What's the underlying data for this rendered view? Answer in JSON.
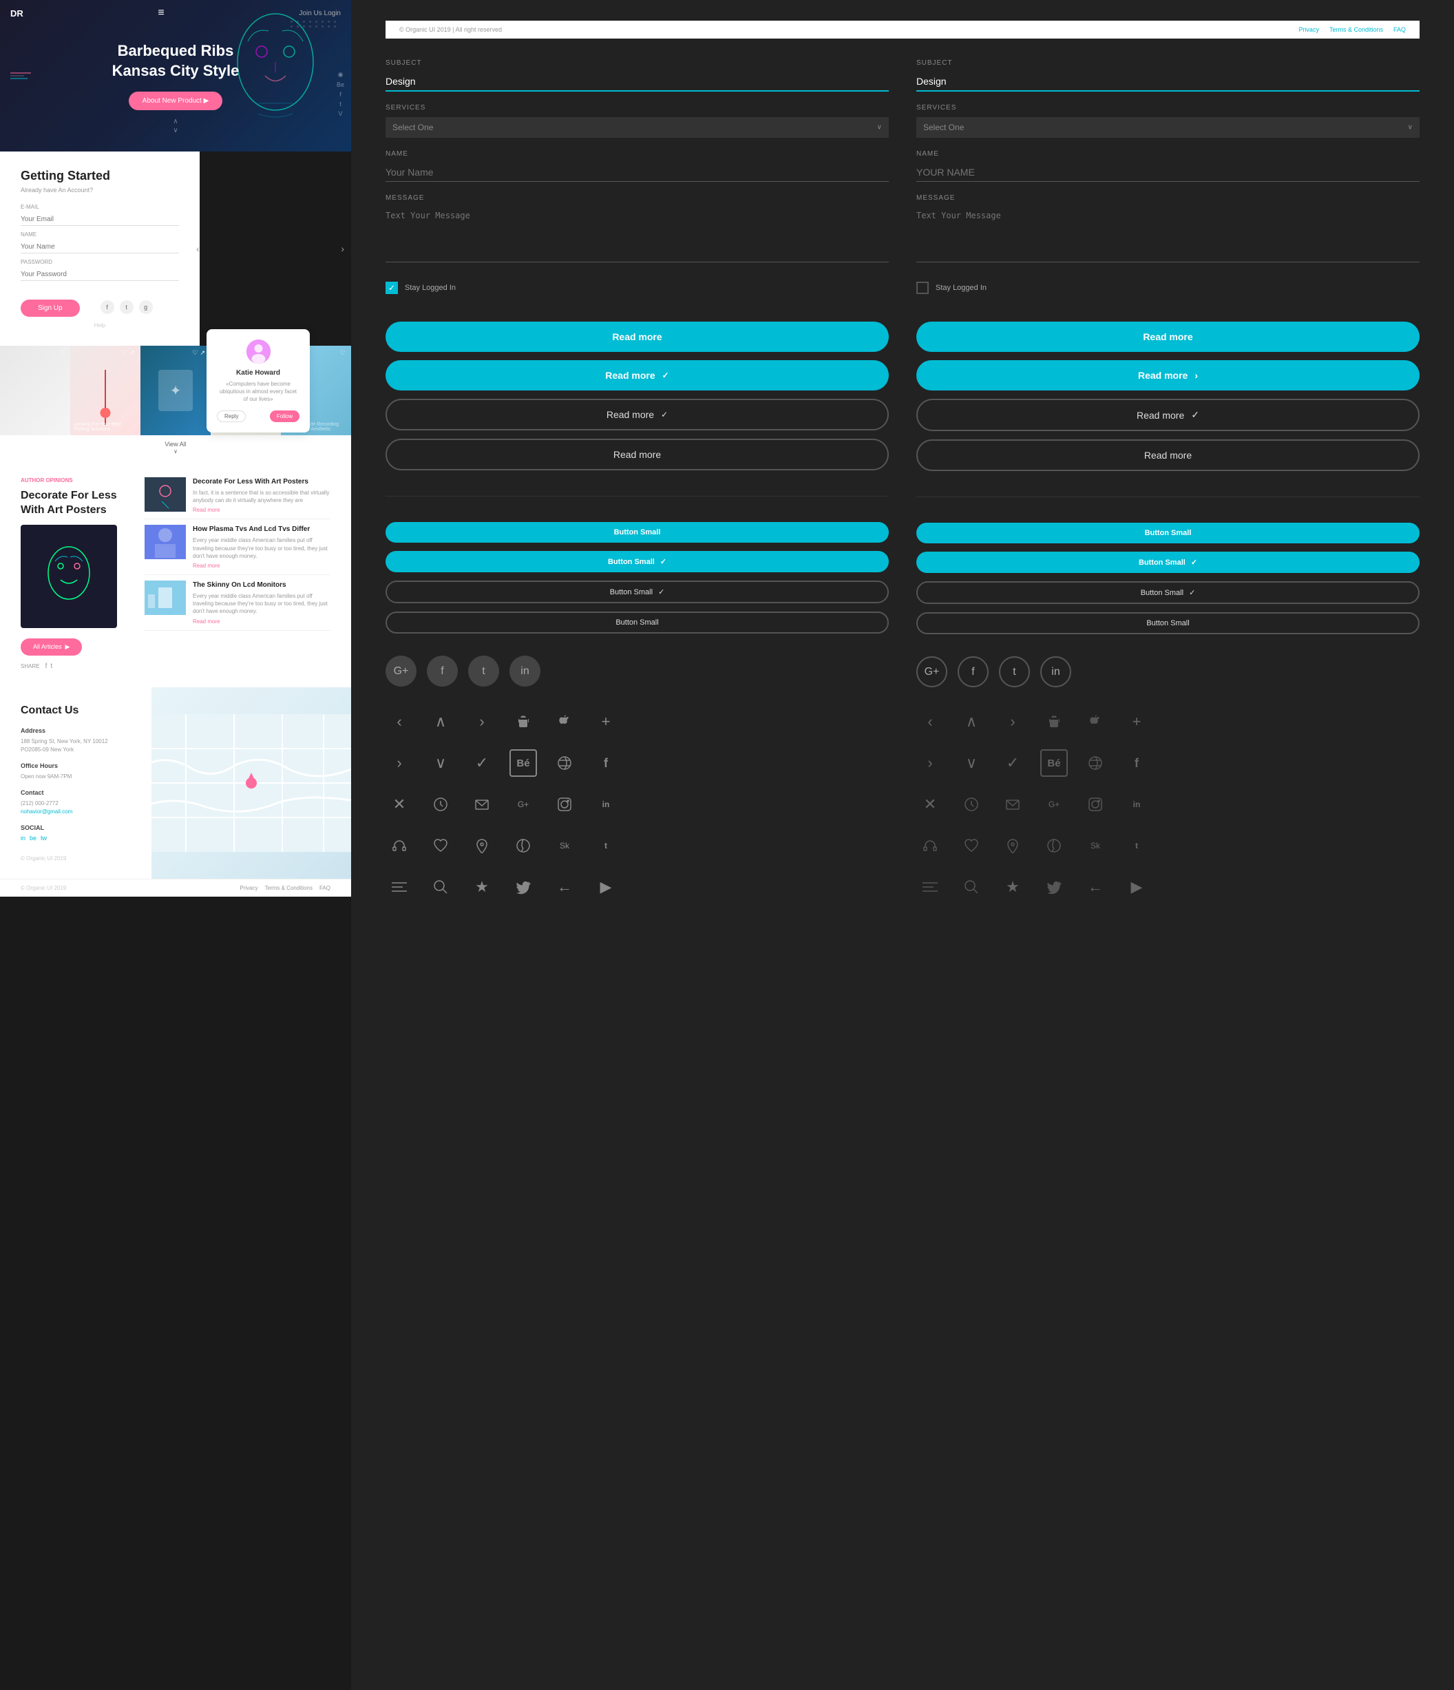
{
  "left": {
    "hero": {
      "logo": "DR",
      "nav_icon": "≡",
      "nav_links": "Join Us  Login",
      "title_line1": "Barbequed Ribs",
      "title_line2": "Kansas City Style",
      "cta_button": "About New Product ▶"
    },
    "getting_started": {
      "title": "Getting Started",
      "subtitle": "Already have An Account?",
      "email_label": "E-MAIL",
      "email_placeholder": "Your Email",
      "name_label": "NAME",
      "name_placeholder": "Your Name",
      "password_label": "PASSWORD",
      "password_placeholder": "Your Password",
      "signup_button": "Sign Up",
      "help_text": "Help",
      "social_icons": [
        "f",
        "t",
        "g"
      ]
    },
    "profile_card": {
      "name": "Katie Howard",
      "text": "«Computers have become ubiquitous in almost every facet of our lives»",
      "btn_reply": "Reply",
      "btn_follow": "Follow"
    },
    "image_grid": {
      "view_all": "View All",
      "cells": [
        {
          "caption": ""
        },
        {
          "caption": "Looking For Your Best Fishing Solutions"
        },
        {
          "caption": ""
        },
        {
          "caption": ""
        },
        {
          "caption": "Urban Life Recording City Aesthetic"
        }
      ]
    },
    "blog": {
      "tag": "AUTHOR OPINIONS",
      "main_title": "Decorate For Less With Art Posters",
      "all_articles": "All Articles",
      "share_label": "SHARE",
      "articles": [
        {
          "title": "Decorate For Less With Art Posters",
          "text": "In fact, it is a sentence that is so accessible that virtually anybody can do it virtually anywhere they are",
          "read_more": "Read more"
        },
        {
          "title": "How Plasma Tvs And Lcd Tvs Differ",
          "text": "Every year middle class American families put off traveling because they're too busy or too tired, they just don't have enough money.",
          "read_more": "Read more"
        },
        {
          "title": "The Skinny On Lcd Monitors",
          "text": "Every year middle class American families put off traveling because they're too busy or too tired, they just don't have enough money.",
          "read_more": "Read more"
        }
      ]
    },
    "contact": {
      "title": "Contact Us",
      "address_label": "Address",
      "address_text": "188 Spring St, New York, NY 10012\nPO2085-09 New York",
      "hours_label": "Office Hours",
      "hours_text": "Open now 9AM-7PM",
      "contact_label": "Contact",
      "phone": "(212) 000-2772",
      "email": "nohavior@gmail.com",
      "social_label": "SOCIAL",
      "social_links": [
        "in",
        "be",
        "tw"
      ],
      "copyright": "© Organic UI 2019"
    },
    "footer": {
      "copyright": "© Organic UI 2019",
      "links": [
        "Privacy",
        "Terms & Conditions",
        "FAQ"
      ]
    }
  },
  "right": {
    "top_bar": {
      "copyright": "© Organic UI 2019 | All right reserved",
      "links": [
        "Privacy",
        "Terms & Conditions",
        "FAQ"
      ]
    },
    "forms": [
      {
        "subject_label": "SUBJECT",
        "subject_value": "Design",
        "services_label": "SERVICES",
        "services_placeholder": "Select One",
        "name_label": "NAME",
        "name_placeholder": "Your Name",
        "message_label": "MESSAGE",
        "message_placeholder": "Text Your Message",
        "stay_logged_label": "Stay Logged In",
        "checked": true
      },
      {
        "subject_label": "SUBJECT",
        "subject_value": "Design",
        "services_label": "SERVICES",
        "services_placeholder": "Select One",
        "name_label": "NAME",
        "name_placeholder": "YOUR NAME",
        "message_label": "MESSAGE",
        "message_placeholder": "Text Your Message",
        "stay_logged_label": "Stay Logged In",
        "checked": false
      }
    ],
    "buttons": {
      "read_more": "Read more",
      "button_small": "Button Small"
    },
    "social_icons_filled": [
      "G+",
      "f",
      "t",
      "in"
    ],
    "social_icons_outline": [
      "G+",
      "f",
      "t",
      "in"
    ],
    "icons": {
      "nav_icons": [
        "‹",
        "∧",
        "›",
        "⚙",
        "",
        "+"
      ],
      "nav_icons2": [
        "›",
        "∨",
        "✓",
        "B̈e",
        "⊕",
        "f"
      ],
      "nav_icons3": [
        "×",
        "◷",
        "✉",
        "G+",
        "◉",
        "in"
      ],
      "nav_icons4": [
        "♡",
        "♡",
        "⊙",
        "♟",
        "S",
        "t"
      ],
      "nav_icons5": [
        "≡",
        "⌕",
        "★",
        "🐦",
        "←",
        "▶"
      ]
    }
  }
}
